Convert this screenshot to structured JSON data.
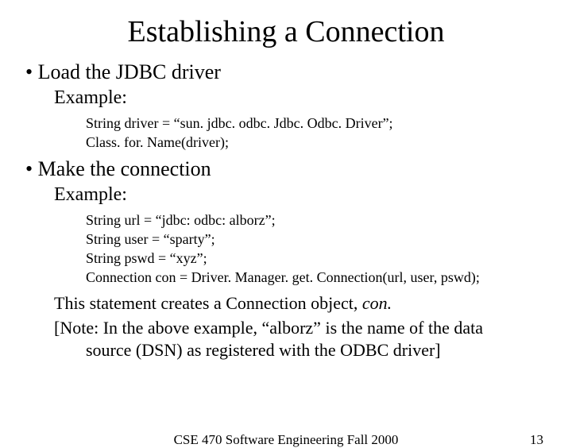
{
  "title": "Establishing a Connection",
  "section1": {
    "bullet": "Load the JDBC driver",
    "example": "Example:",
    "code1": "String driver = “sun. jdbc. odbc. Jdbc. Odbc. Driver”;",
    "code2": "Class. for. Name(driver);"
  },
  "section2": {
    "bullet": "Make the connection",
    "example": "Example:",
    "code1": "String url = “jdbc: odbc: alborz”;",
    "code2": "String user = “sparty”;",
    "code3": "String pswd = “xyz”;",
    "code4": "Connection con = Driver. Manager. get. Connection(url, user, pswd);"
  },
  "note": {
    "line1a": "This statement creates a Connection object, ",
    "line1b": "con.",
    "line2": "[Note:  In the above example, “alborz” is the name of the data",
    "line3": "source (DSN) as registered with the ODBC driver]"
  },
  "footer": {
    "center": "CSE 470    Software Engineering    Fall 2000",
    "page": "13"
  }
}
